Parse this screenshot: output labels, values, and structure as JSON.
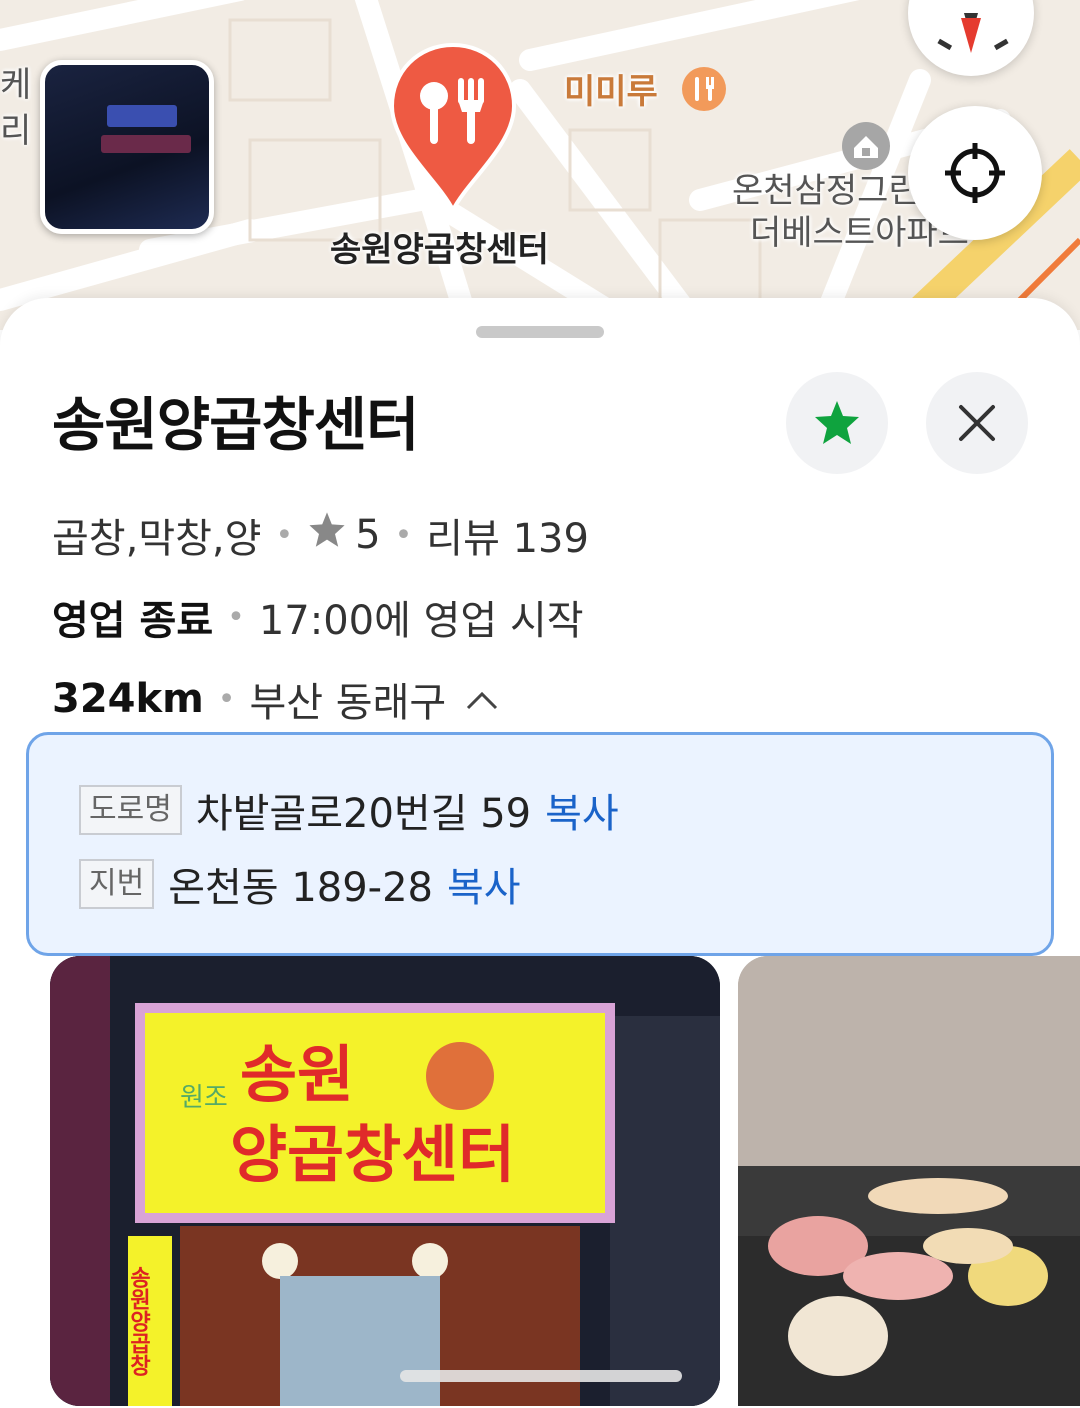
{
  "map": {
    "pin_label": "송원양곱창센터",
    "poi_label": "미미루",
    "apartment_label_line1": "온천삼정그린",
    "apartment_label_line2": "더베스트아파트",
    "edge_label_line1": "케",
    "edge_label_line2": "리",
    "top_faded_label": "",
    "icons": {
      "pin": "restaurant-pin-icon",
      "poi": "restaurant-icon",
      "apartment": "building-icon",
      "compass": "compass-icon",
      "locate": "crosshair-icon"
    },
    "colors": {
      "pin": "#ee5a43",
      "poi": "#f29a5a"
    }
  },
  "place": {
    "title": "송원양곱창센터",
    "category": "곱창,막창,양",
    "rating": "5",
    "reviews": "리뷰 139",
    "status": "영업 종료",
    "hours": "17:00에 영업 시작",
    "distance": "324km",
    "region": "부산 동래구",
    "favorite_color": "#0fa33e"
  },
  "address": {
    "road_tag": "도로명",
    "road_value": "차밭골로20번길 59",
    "lot_tag": "지번",
    "lot_value": "온천동 189-28",
    "copy_label": "복사",
    "copy_color": "#1a63c9"
  },
  "photos": {
    "sign_top": "송원",
    "sign_main": "양곱창센터",
    "sign_side_small": "원조",
    "vertical_sign": "송원양곱창"
  }
}
